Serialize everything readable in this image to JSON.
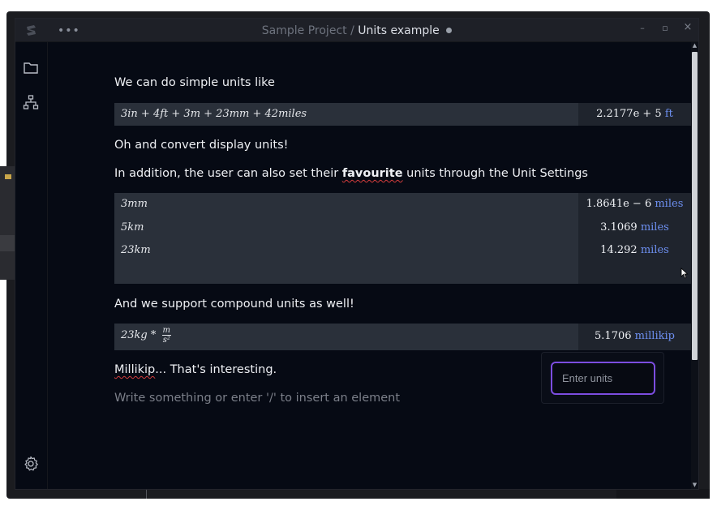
{
  "window": {
    "project": "Sample Project",
    "separator": "/",
    "file": "Units example",
    "controls": [
      "–",
      "▫",
      "×"
    ]
  },
  "sidebar": {
    "icons": [
      "folder-icon",
      "hierarchy-icon",
      "settings-gear-icon"
    ]
  },
  "content": {
    "p1": "We can do simple units like",
    "block1": {
      "expression": "3in + 4ft + 3m + 23mm + 42miles",
      "result_value": "2.2177e + 5",
      "result_unit": "ft"
    },
    "p2": "Oh and convert display units!",
    "p3": {
      "before": "In addition, the user can also set their ",
      "bold": "favourite",
      "after": " units through the Unit Settings"
    },
    "block2": {
      "rows": [
        {
          "expression": "3mm",
          "result_value": "1.8641e − 6",
          "result_unit": "miles"
        },
        {
          "expression": "5km",
          "result_value": "3.1069",
          "result_unit": "miles"
        },
        {
          "expression": "23km",
          "result_value": "14.292",
          "result_unit": "miles"
        }
      ]
    },
    "p4": "And we support compound units as well!",
    "block3": {
      "expression_prefix": "23kg *",
      "frac_num": "m",
      "frac_den": "s²",
      "result_value": "5.1706",
      "result_unit": "millikip"
    },
    "p5": {
      "word": "Millikip",
      "rest": "... That's interesting."
    },
    "placeholder": "Write something or enter '/' to insert an element"
  },
  "unit_popup": {
    "placeholder": "Enter units"
  },
  "colors": {
    "accent": "#7c4de0",
    "unit_blue": "#6d8ff0",
    "background": "#060a14"
  }
}
